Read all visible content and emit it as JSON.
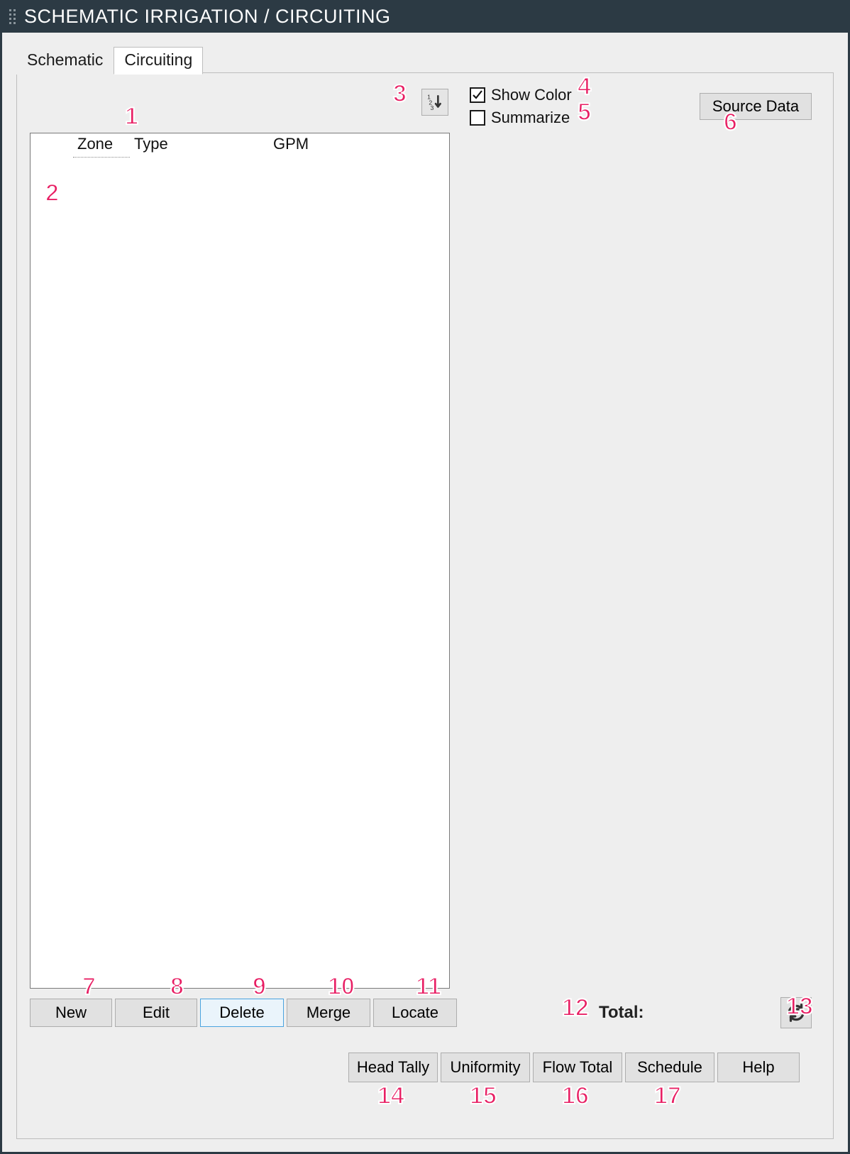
{
  "window": {
    "title": "SCHEMATIC IRRIGATION / CIRCUITING"
  },
  "tabs": {
    "schematic": "Schematic",
    "circuiting": "Circuiting"
  },
  "renumber_icon": "renumber",
  "checkboxes": {
    "show_color": {
      "label": "Show Color",
      "checked": true
    },
    "summarize": {
      "label": "Summarize",
      "checked": false
    }
  },
  "source_data_btn": "Source Data",
  "grid": {
    "columns": {
      "zone": "Zone",
      "type": "Type",
      "gpm": "GPM"
    },
    "rows": []
  },
  "row_buttons": {
    "new": "New",
    "edit": "Edit",
    "delete": "Delete",
    "merge": "Merge",
    "locate": "Locate"
  },
  "total_label": "Total:",
  "refresh_icon": "refresh",
  "bottom_buttons": {
    "head_tally": "Head Tally",
    "uniformity": "Uniformity",
    "flow_total": "Flow Total",
    "schedule": "Schedule",
    "help": "Help"
  },
  "annotations": {
    "n1": "1",
    "n2": "2",
    "n3": "3",
    "n4": "4",
    "n5": "5",
    "n6": "6",
    "n7": "7",
    "n8": "8",
    "n9": "9",
    "n10": "10",
    "n11": "11",
    "n12": "12",
    "n13": "13",
    "n14": "14",
    "n15": "15",
    "n16": "16",
    "n17": "17"
  }
}
